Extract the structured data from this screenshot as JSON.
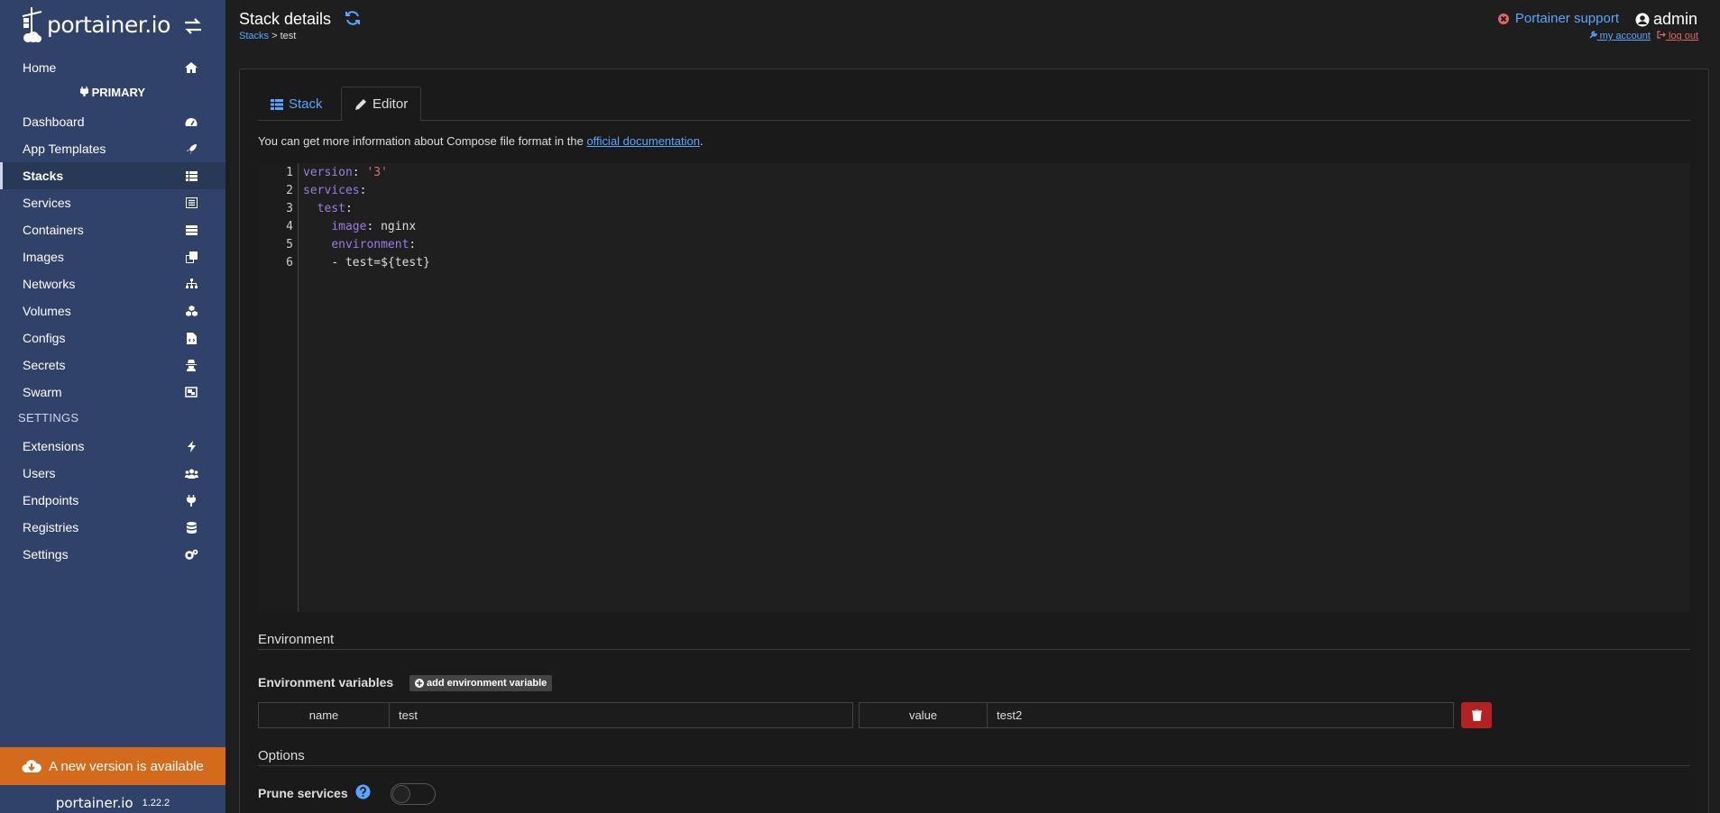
{
  "app": {
    "logo_text": "portainer.io",
    "version": "1.22.2"
  },
  "sidebar": {
    "home_label": "Home",
    "endpoint_label": "PRIMARY",
    "items": [
      {
        "label": "Dashboard",
        "icon": "tachometer-icon"
      },
      {
        "label": "App Templates",
        "icon": "rocket-icon"
      },
      {
        "label": "Stacks",
        "icon": "th-list-icon",
        "active": true
      },
      {
        "label": "Services",
        "icon": "list-alt-icon"
      },
      {
        "label": "Containers",
        "icon": "server-icon"
      },
      {
        "label": "Images",
        "icon": "clone-icon"
      },
      {
        "label": "Networks",
        "icon": "sitemap-icon"
      },
      {
        "label": "Volumes",
        "icon": "cubes-icon"
      },
      {
        "label": "Configs",
        "icon": "file-code-icon"
      },
      {
        "label": "Secrets",
        "icon": "user-secret-icon"
      },
      {
        "label": "Swarm",
        "icon": "object-group-icon"
      }
    ],
    "settings_heading": "SETTINGS",
    "settings_items": [
      {
        "label": "Extensions",
        "icon": "bolt-icon"
      },
      {
        "label": "Users",
        "icon": "users-icon"
      },
      {
        "label": "Endpoints",
        "icon": "plug-icon"
      },
      {
        "label": "Registries",
        "icon": "database-icon"
      },
      {
        "label": "Settings",
        "icon": "cogs-icon"
      }
    ],
    "update_banner": "A new version is available"
  },
  "header": {
    "title": "Stack details",
    "breadcrumb_root": "Stacks",
    "breadcrumb_sep": " > ",
    "breadcrumb_current": "test",
    "support_label": "Portainer support",
    "username": "admin",
    "my_account_label": "my account",
    "logout_label": "log out"
  },
  "tabs": {
    "stack_label": "Stack",
    "editor_label": "Editor"
  },
  "info": {
    "prefix": "You can get more information about Compose file format in the ",
    "link_text": "official documentation",
    "suffix": "."
  },
  "editor": {
    "line_numbers": [
      "1",
      "2",
      "3",
      "4",
      "5",
      "6"
    ],
    "lines": [
      {
        "key": "version",
        "sep": ": ",
        "value": "'3'"
      },
      {
        "key": "services",
        "sep": ":",
        "value": ""
      },
      {
        "indent": "  ",
        "key": "test",
        "sep": ":",
        "value": ""
      },
      {
        "indent": "    ",
        "key": "image",
        "sep": ": ",
        "plain": "nginx"
      },
      {
        "indent": "    ",
        "key": "environment",
        "sep": ":",
        "value": ""
      },
      {
        "indent": "    ",
        "plain": "- test=${test}"
      }
    ]
  },
  "environment": {
    "section_title": "Environment",
    "vars_label": "Environment variables",
    "add_button": "add environment variable",
    "name_addon": "name",
    "name_value": "test",
    "value_addon": "value",
    "value_value": "test2"
  },
  "options": {
    "section_title": "Options",
    "prune_label": "Prune services",
    "prune_enabled": false
  },
  "colors": {
    "sidebar": "#30426a",
    "link": "#58a6ff",
    "banner": "#d36a1c",
    "danger": "#b32222"
  }
}
